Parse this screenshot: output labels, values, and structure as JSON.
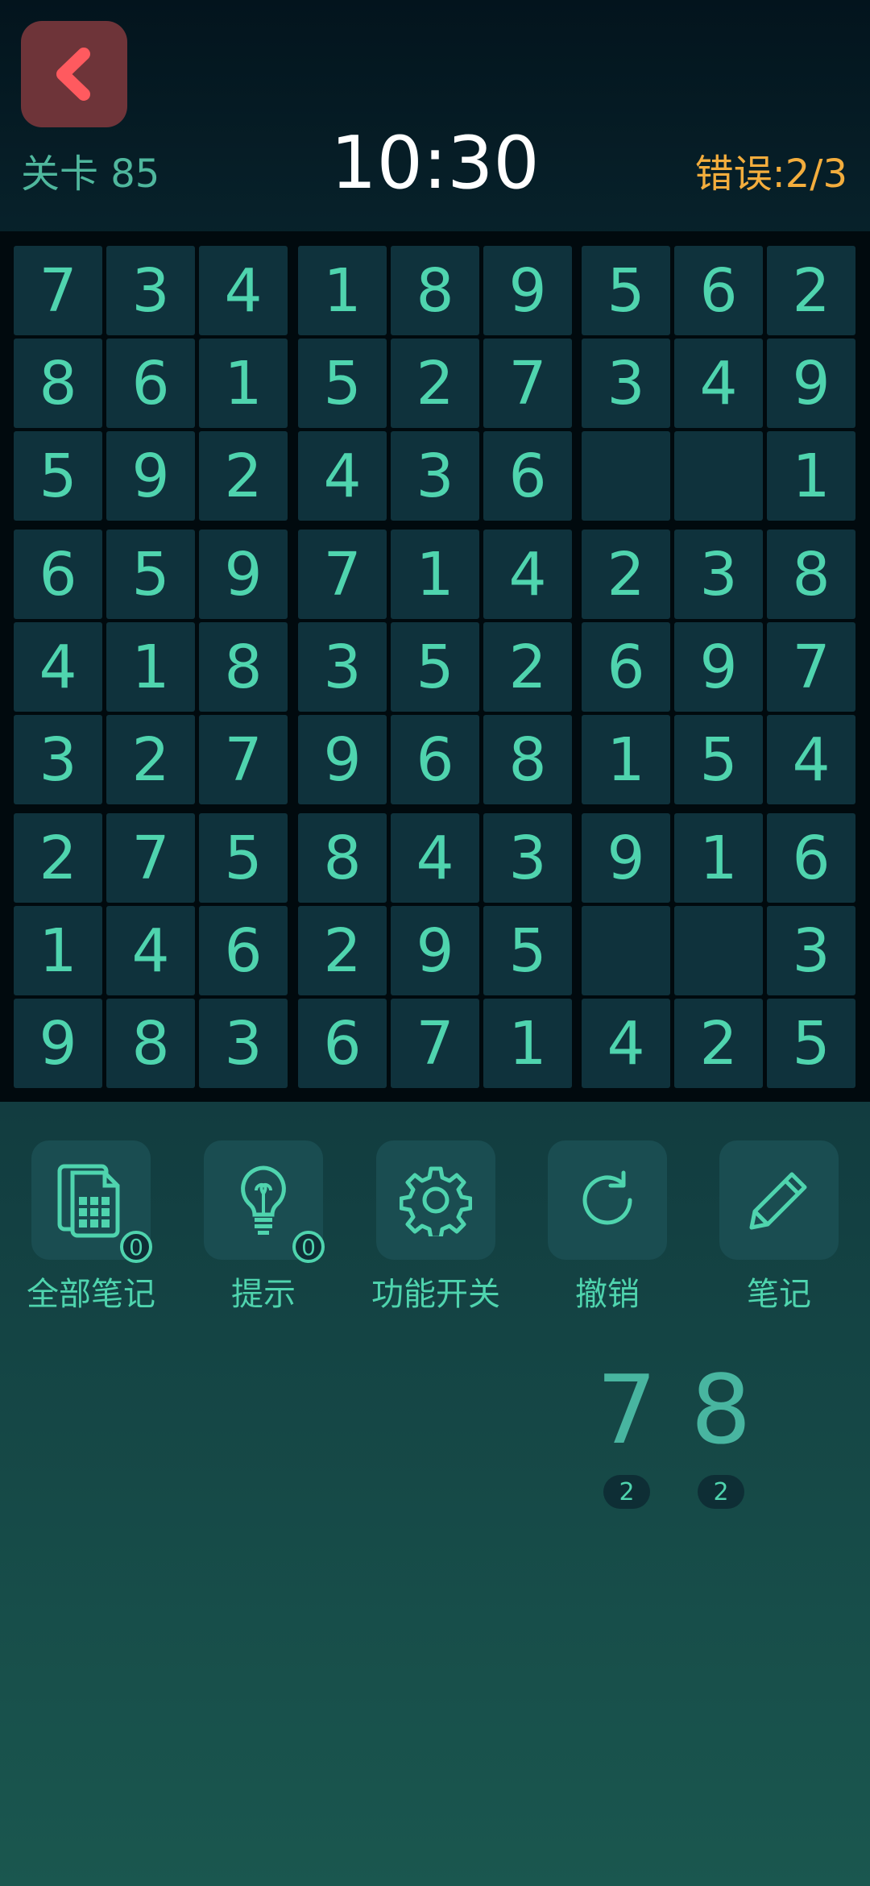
{
  "header": {
    "level_label": "关卡 85",
    "timer": "10:30",
    "errors": "错误:2/3",
    "back_icon": "chevron-left-icon"
  },
  "colors": {
    "back_button": "#6e3439",
    "back_icon": "#ff5a5f",
    "digit": "#4fd4ae",
    "errors": "#f3ad3d",
    "cell": "#0f323c"
  },
  "grid": [
    [
      "7",
      "3",
      "4",
      "1",
      "8",
      "9",
      "5",
      "6",
      "2"
    ],
    [
      "8",
      "6",
      "1",
      "5",
      "2",
      "7",
      "3",
      "4",
      "9"
    ],
    [
      "5",
      "9",
      "2",
      "4",
      "3",
      "6",
      "",
      "",
      "1"
    ],
    [
      "6",
      "5",
      "9",
      "7",
      "1",
      "4",
      "2",
      "3",
      "8"
    ],
    [
      "4",
      "1",
      "8",
      "3",
      "5",
      "2",
      "6",
      "9",
      "7"
    ],
    [
      "3",
      "2",
      "7",
      "9",
      "6",
      "8",
      "1",
      "5",
      "4"
    ],
    [
      "2",
      "7",
      "5",
      "8",
      "4",
      "3",
      "9",
      "1",
      "6"
    ],
    [
      "1",
      "4",
      "6",
      "2",
      "9",
      "5",
      "",
      "",
      "3"
    ],
    [
      "9",
      "8",
      "3",
      "6",
      "7",
      "1",
      "4",
      "2",
      "5"
    ]
  ],
  "toolbar": [
    {
      "label": "全部笔记",
      "icon": "notes-grid-icon",
      "badge": "0"
    },
    {
      "label": "提示",
      "icon": "lightbulb-icon",
      "badge": "0"
    },
    {
      "label": "功能开关",
      "icon": "gear-icon"
    },
    {
      "label": "撤销",
      "icon": "undo-icon"
    },
    {
      "label": "笔记",
      "icon": "pencil-icon"
    }
  ],
  "numpad": [
    {
      "digit": "7",
      "count": "2"
    },
    {
      "digit": "8",
      "count": "2"
    }
  ]
}
